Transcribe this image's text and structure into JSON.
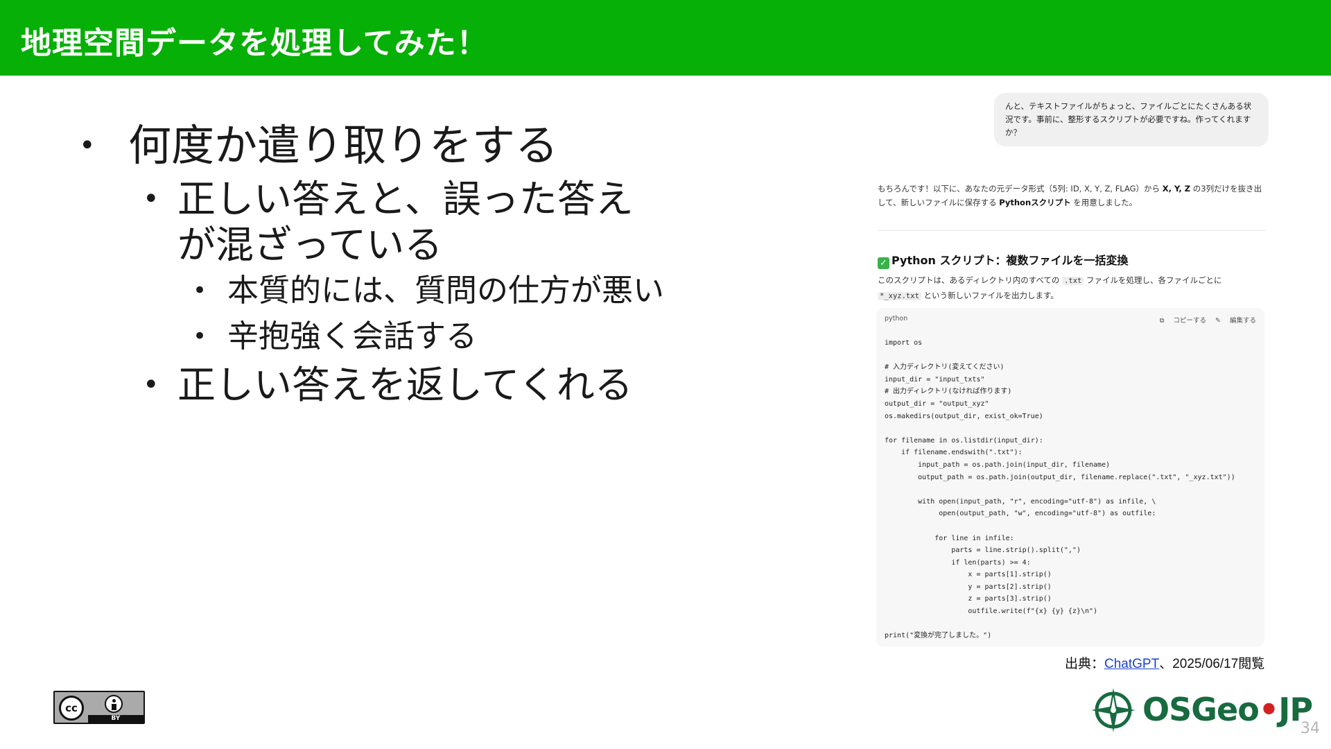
{
  "header": {
    "title": "地理空間データを処理してみた！"
  },
  "bullets": {
    "l1_a": "何度か遣り取りをする",
    "l2_a": "正しい答えと、誤った答えが混ざっている",
    "l3_a": "本質的には、質問の仕方が悪い",
    "l3_b": "辛抱強く会話する",
    "l2_b": "正しい答えを返してくれる",
    "marker": "•"
  },
  "chat": {
    "user_message": "んと、テキストファイルがちょっと、ファイルごとにたくさんある状況です。事前に、整形するスクリプトが必要ですね。作ってくれますか？",
    "reply_intro_1": "もちろんです！以下に、あなたの元データ形式（5列: ID, X, Y, Z, FLAG）から ",
    "reply_intro_bold_1": "X, Y, Z",
    "reply_intro_2": " の3列だけを抜き出して、新しいファイルに保存する ",
    "reply_intro_bold_2": "Pythonスクリプト",
    "reply_intro_3": " を用意しました。",
    "section_title": "Python スクリプト：複数ファイルを一括変換",
    "section_desc_1": "このスクリプトは、あるディレクトリ内のすべての ",
    "section_desc_tag1": ".txt",
    "section_desc_2": " ファイルを処理し、各ファイルごとに ",
    "section_desc_tag2": "*_xyz.txt",
    "section_desc_3": " という新しいファイルを出力します。",
    "code_lang": "python",
    "copy_label": "コピーする",
    "edit_label": "編集する",
    "code": "import os\n\n# 入力ディレクトリ(変えてください)\ninput_dir = \"input_txts\"\n# 出力ディレクトリ(なければ作ります)\noutput_dir = \"output_xyz\"\nos.makedirs(output_dir, exist_ok=True)\n\nfor filename in os.listdir(input_dir):\n    if filename.endswith(\".txt\"):\n        input_path = os.path.join(input_dir, filename)\n        output_path = os.path.join(output_dir, filename.replace(\".txt\", \"_xyz.txt\"))\n\n        with open(input_path, \"r\", encoding=\"utf-8\") as infile, \\\n             open(output_path, \"w\", encoding=\"utf-8\") as outfile:\n\n            for line in infile:\n                parts = line.strip().split(\",\")\n                if len(parts) >= 4:\n                    x = parts[1].strip()\n                    y = parts[2].strip()\n                    z = parts[3].strip()\n                    outfile.write(f\"{x} {y} {z}\\n\")\n\nprint(\"変換が完了しました。\")"
  },
  "source": {
    "prefix": "出典：",
    "link_text": "ChatGPT",
    "suffix": "、2025/06/17閲覧"
  },
  "license": {
    "cc": "cc",
    "by": "BY"
  },
  "logo": {
    "text_a": "OSGeo",
    "dot": "•",
    "text_b": "JP"
  },
  "page_number": "34",
  "colors": {
    "header_bg": "#06b006",
    "logo_green": "#176b3f",
    "logo_red": "#d42020",
    "link": "#1a3fd6"
  }
}
